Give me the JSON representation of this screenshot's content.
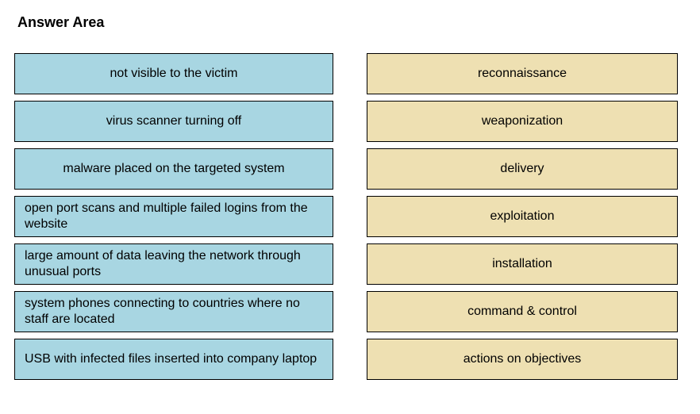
{
  "title": "Answer Area",
  "left": [
    {
      "text": "not visible to the victim",
      "align": "center"
    },
    {
      "text": "virus scanner turning off",
      "align": "center"
    },
    {
      "text": "malware placed on the targeted system",
      "align": "center"
    },
    {
      "text": "open port scans and multiple failed logins from the website",
      "align": "left"
    },
    {
      "text": "large amount of data leaving the network through unusual ports",
      "align": "left"
    },
    {
      "text": "system phones connecting to countries where no staff are located",
      "align": "left"
    },
    {
      "text": "USB with infected files inserted into company laptop",
      "align": "left"
    }
  ],
  "right": [
    {
      "text": "reconnaissance"
    },
    {
      "text": "weaponization"
    },
    {
      "text": "delivery"
    },
    {
      "text": "exploitation"
    },
    {
      "text": "installation"
    },
    {
      "text": "command & control"
    },
    {
      "text": "actions on objectives"
    }
  ]
}
